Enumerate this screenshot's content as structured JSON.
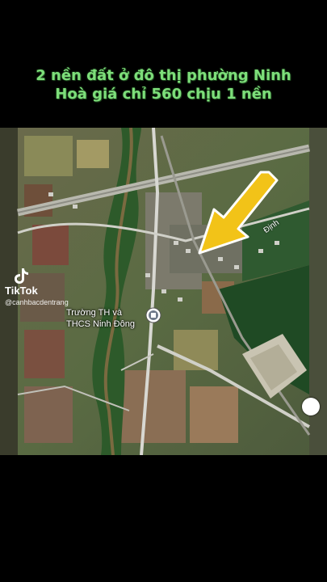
{
  "caption": "2 nền đất ở đô thị phường Ninh Hoà giá chỉ 560 chịu 1 nền",
  "tiktok": {
    "brand": "TikTok",
    "username": "@canhbacdentrang"
  },
  "map": {
    "school_label_line1": "Trường TH và",
    "school_label_line2": "THCS Ninh Đông",
    "road_label": "Định",
    "arrow_color": "#f2c318",
    "icons": [
      "tiktok-logo-icon",
      "school-pin-icon",
      "compass-icon",
      "arrow-pointer-icon"
    ]
  }
}
